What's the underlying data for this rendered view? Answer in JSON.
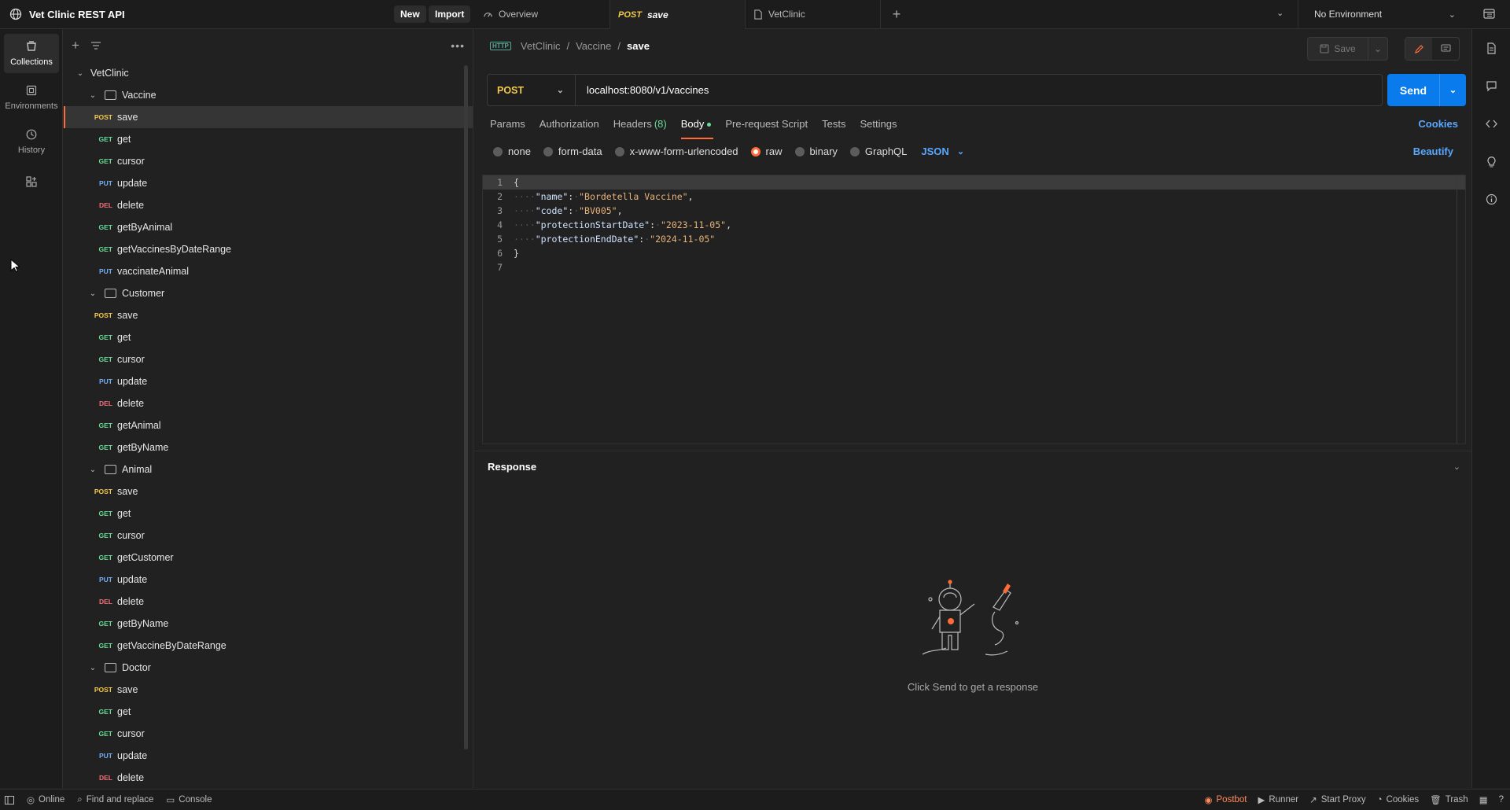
{
  "workspace": {
    "title": "Vet Clinic REST API",
    "new_label": "New",
    "import_label": "Import"
  },
  "tabs": [
    {
      "label": "Overview",
      "method": ""
    },
    {
      "label": "save",
      "method": "POST"
    },
    {
      "label": "VetClinic",
      "method": ""
    }
  ],
  "environment": {
    "selected": "No Environment"
  },
  "rail": [
    {
      "label": "Collections",
      "icon": "collections-icon"
    },
    {
      "label": "Environments",
      "icon": "environments-icon"
    },
    {
      "label": "History",
      "icon": "history-icon"
    }
  ],
  "sidebar": {
    "collection": "VetClinic",
    "folders": [
      {
        "name": "Vaccine",
        "requests": [
          {
            "method": "POST",
            "name": "save"
          },
          {
            "method": "GET",
            "name": "get"
          },
          {
            "method": "GET",
            "name": "cursor"
          },
          {
            "method": "PUT",
            "name": "update"
          },
          {
            "method": "DEL",
            "name": "delete"
          },
          {
            "method": "GET",
            "name": "getByAnimal"
          },
          {
            "method": "GET",
            "name": "getVaccinesByDateRange"
          },
          {
            "method": "PUT",
            "name": "vaccinateAnimal"
          }
        ]
      },
      {
        "name": "Customer",
        "requests": [
          {
            "method": "POST",
            "name": "save"
          },
          {
            "method": "GET",
            "name": "get"
          },
          {
            "method": "GET",
            "name": "cursor"
          },
          {
            "method": "PUT",
            "name": "update"
          },
          {
            "method": "DEL",
            "name": "delete"
          },
          {
            "method": "GET",
            "name": "getAnimal"
          },
          {
            "method": "GET",
            "name": "getByName"
          }
        ]
      },
      {
        "name": "Animal",
        "requests": [
          {
            "method": "POST",
            "name": "save"
          },
          {
            "method": "GET",
            "name": "get"
          },
          {
            "method": "GET",
            "name": "cursor"
          },
          {
            "method": "GET",
            "name": "getCustomer"
          },
          {
            "method": "PUT",
            "name": "update"
          },
          {
            "method": "DEL",
            "name": "delete"
          },
          {
            "method": "GET",
            "name": "getByName"
          },
          {
            "method": "GET",
            "name": "getVaccineByDateRange"
          }
        ]
      },
      {
        "name": "Doctor",
        "requests": [
          {
            "method": "POST",
            "name": "save"
          },
          {
            "method": "GET",
            "name": "get"
          },
          {
            "method": "GET",
            "name": "cursor"
          },
          {
            "method": "PUT",
            "name": "update"
          },
          {
            "method": "DEL",
            "name": "delete"
          }
        ]
      }
    ]
  },
  "request": {
    "breadcrumb": [
      "VetClinic",
      "Vaccine",
      "save"
    ],
    "save_label": "Save",
    "method": "POST",
    "url": "localhost:8080/v1/vaccines",
    "send_label": "Send",
    "tabs": {
      "params": "Params",
      "authorization": "Authorization",
      "headers": "Headers",
      "headers_count": "(8)",
      "body": "Body",
      "prerequest": "Pre-request Script",
      "tests": "Tests",
      "settings": "Settings"
    },
    "cookies_label": "Cookies",
    "body_options": [
      "none",
      "form-data",
      "x-www-form-urlencoded",
      "raw",
      "binary",
      "GraphQL"
    ],
    "body_selected": "raw",
    "format": "JSON",
    "beautify_label": "Beautify",
    "code_lines": [
      "1",
      "2",
      "3",
      "4",
      "5",
      "6",
      "7"
    ],
    "body_fields": {
      "name_key": "\"name\"",
      "name_val": "\"Bordetella Vaccine\"",
      "code_key": "\"code\"",
      "code_val": "\"BV005\"",
      "start_key": "\"protectionStartDate\"",
      "start_val": "\"2023-11-05\"",
      "end_key": "\"protectionEndDate\"",
      "end_val": "\"2024-11-05\""
    }
  },
  "response": {
    "title": "Response",
    "hint": "Click Send to get a response"
  },
  "statusbar": {
    "online": "Online",
    "find": "Find and replace",
    "console": "Console",
    "postbot": "Postbot",
    "runner": "Runner",
    "proxy": "Start Proxy",
    "cookies": "Cookies",
    "trash": "Trash"
  },
  "colors": {
    "accent": "#ff6c37",
    "send": "#097bed",
    "get": "#6bdd9a",
    "post": "#f2c94c",
    "put": "#74aef6",
    "del": "#f07178"
  }
}
